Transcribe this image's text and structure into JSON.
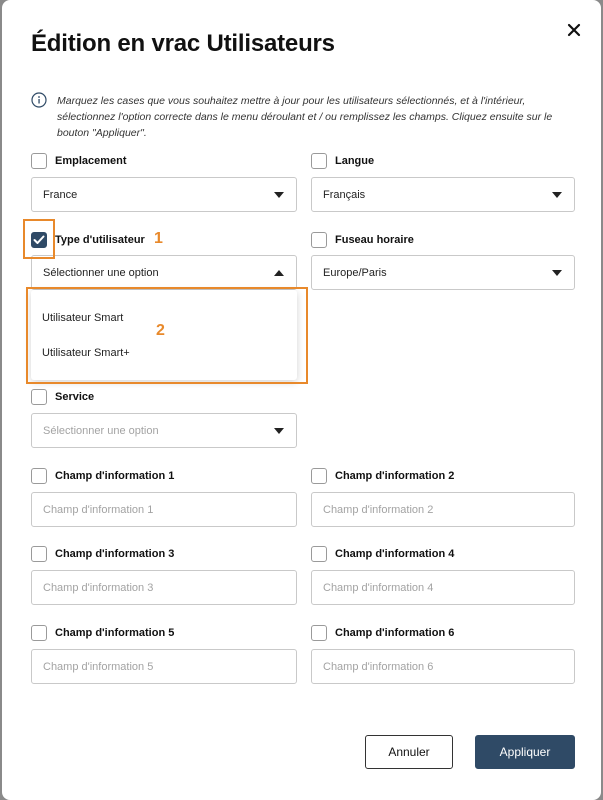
{
  "modal": {
    "title": "Édition en vrac Utilisateurs",
    "info_text": "Marquez les cases que vous souhaitez mettre à jour pour les utilisateurs sélectionnés, et à l'intérieur, sélectionnez l'option correcte dans le menu déroulant et / ou remplissez les champs. Cliquez ensuite sur le bouton \"Appliquer\"."
  },
  "fields": {
    "emplacement": {
      "label": "Emplacement",
      "value": "France",
      "checked": false
    },
    "langue": {
      "label": "Langue",
      "value": "Français",
      "checked": false
    },
    "type_utilisateur": {
      "label": "Type d'utilisateur",
      "value": "Sélectionner une option",
      "checked": true,
      "open": true
    },
    "fuseau": {
      "label": "Fuseau horaire",
      "value": "Europe/Paris",
      "checked": false
    },
    "service": {
      "label": "Service",
      "placeholder": "Sélectionner une option",
      "checked": false
    },
    "info1": {
      "label": "Champ d'information 1",
      "placeholder": "Champ d'information 1"
    },
    "info2": {
      "label": "Champ d'information 2",
      "placeholder": "Champ d'information 2"
    },
    "info3": {
      "label": "Champ d'information 3",
      "placeholder": "Champ d'information 3"
    },
    "info4": {
      "label": "Champ d'information 4",
      "placeholder": "Champ d'information 4"
    },
    "info5": {
      "label": "Champ d'information 5",
      "placeholder": "Champ d'information 5"
    },
    "info6": {
      "label": "Champ d'information 6",
      "placeholder": "Champ d'information 6"
    }
  },
  "dropdown_options": [
    "Utilisateur Smart",
    "Utilisateur Smart+"
  ],
  "annotations": {
    "num1": "1",
    "num2": "2",
    "color": "#e8892b"
  },
  "buttons": {
    "cancel": "Annuler",
    "apply": "Appliquer"
  },
  "colors": {
    "primary": "#2f4a66"
  }
}
